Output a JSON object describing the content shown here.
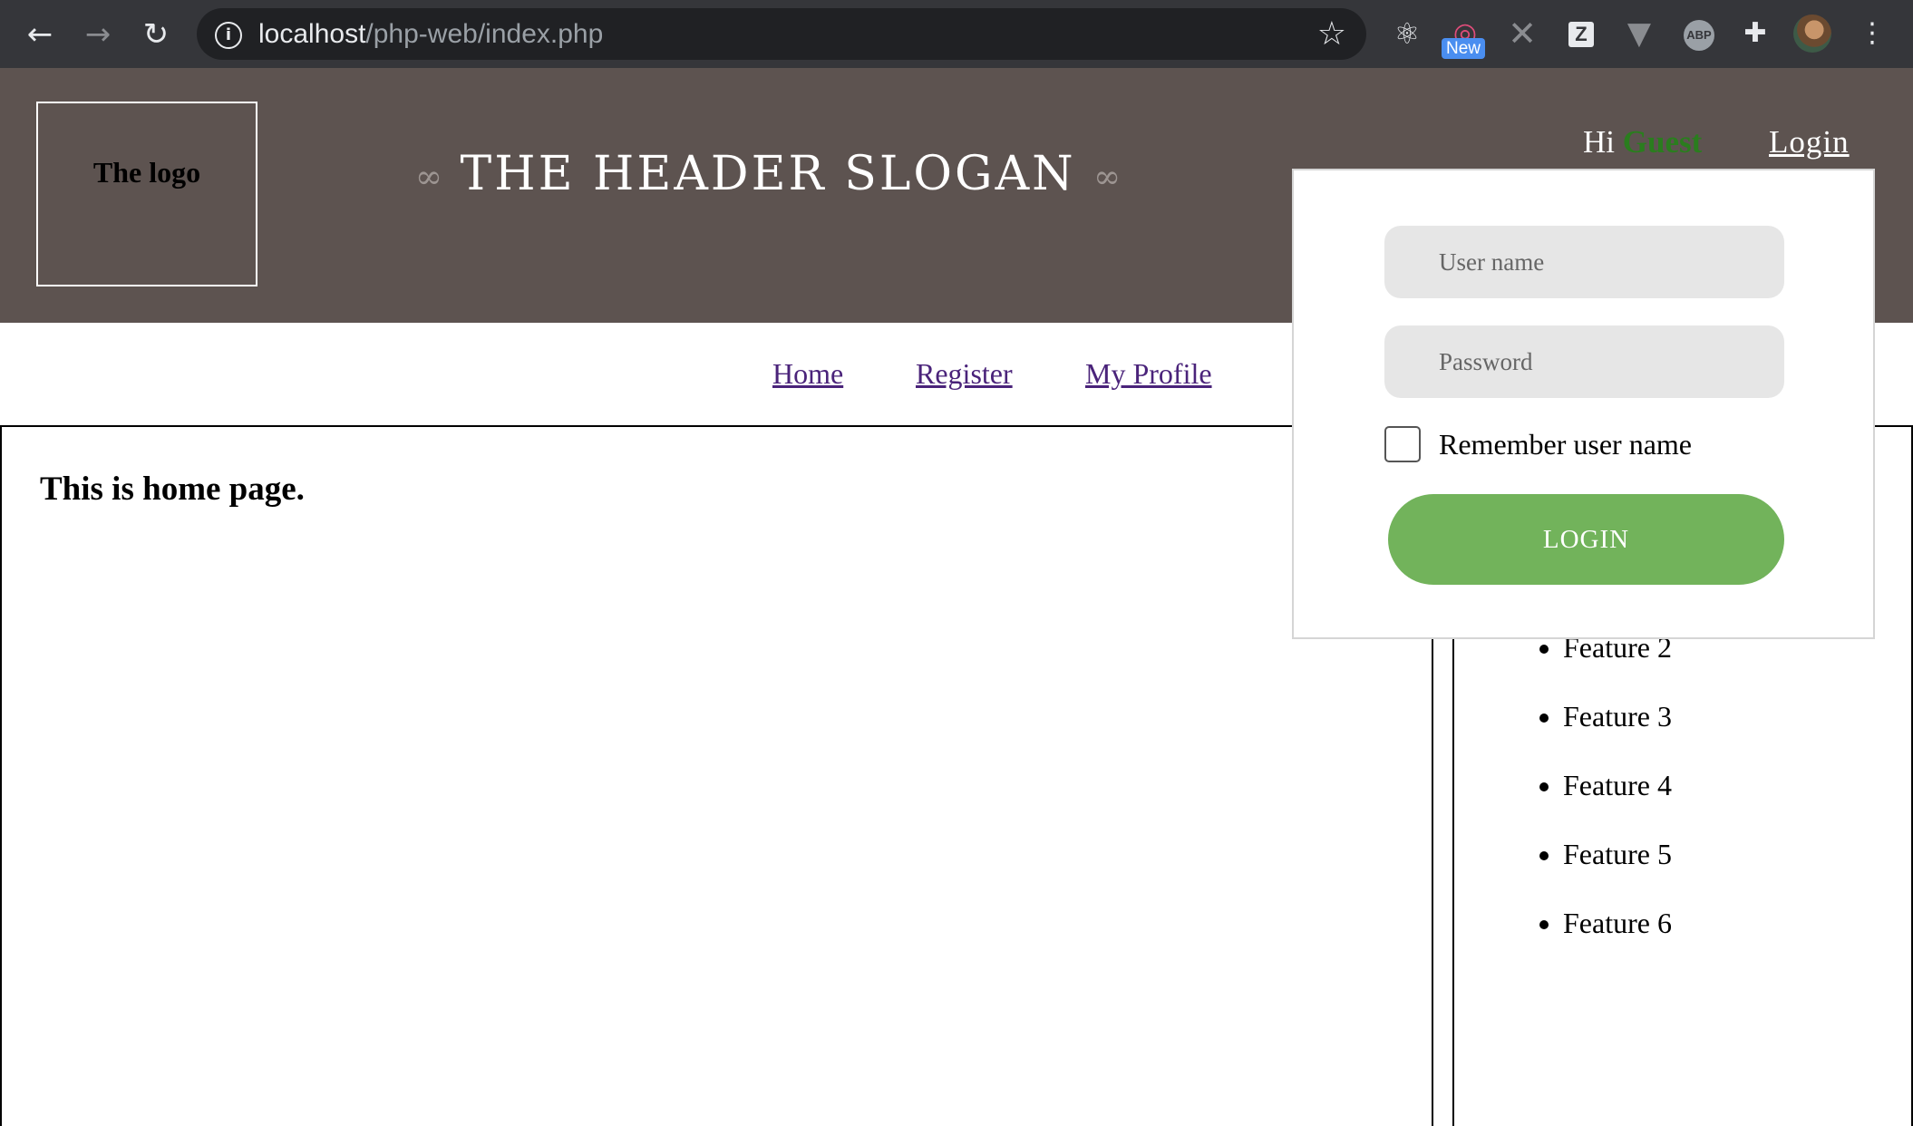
{
  "browser": {
    "url_host": "localhost",
    "url_path": "/php-web/index.php",
    "extensions": [
      "react-devtools-icon",
      "instagram-icon",
      "x-icon",
      "zotero-icon",
      "vue-devtools-icon",
      "adblock-plus-icon",
      "puzzle-icon"
    ],
    "new_badge": "New",
    "zotero_label": "Z",
    "abp_label": "ABP"
  },
  "header": {
    "logo": "The logo",
    "slogan": "THE HEADER SLOGAN",
    "greeting_hi": "Hi",
    "greeting_name": "Guest",
    "login_link": "Login"
  },
  "nav": {
    "items": [
      {
        "label": "Home"
      },
      {
        "label": "Register"
      },
      {
        "label": "My Profile"
      }
    ]
  },
  "main": {
    "heading": "This is home page."
  },
  "sidebar": {
    "features": [
      {
        "label": "Feature 2"
      },
      {
        "label": "Feature 3"
      },
      {
        "label": "Feature 4"
      },
      {
        "label": "Feature 5"
      },
      {
        "label": "Feature 6"
      }
    ]
  },
  "login_form": {
    "username_placeholder": "User name",
    "password_placeholder": "Password",
    "remember_label": "Remember user name",
    "submit_label": "LOGIN"
  },
  "colors": {
    "header_bg": "#5d5350",
    "guest_name": "#2a7d1e",
    "login_button": "#72b35b",
    "nav_link": "#4a237a"
  }
}
